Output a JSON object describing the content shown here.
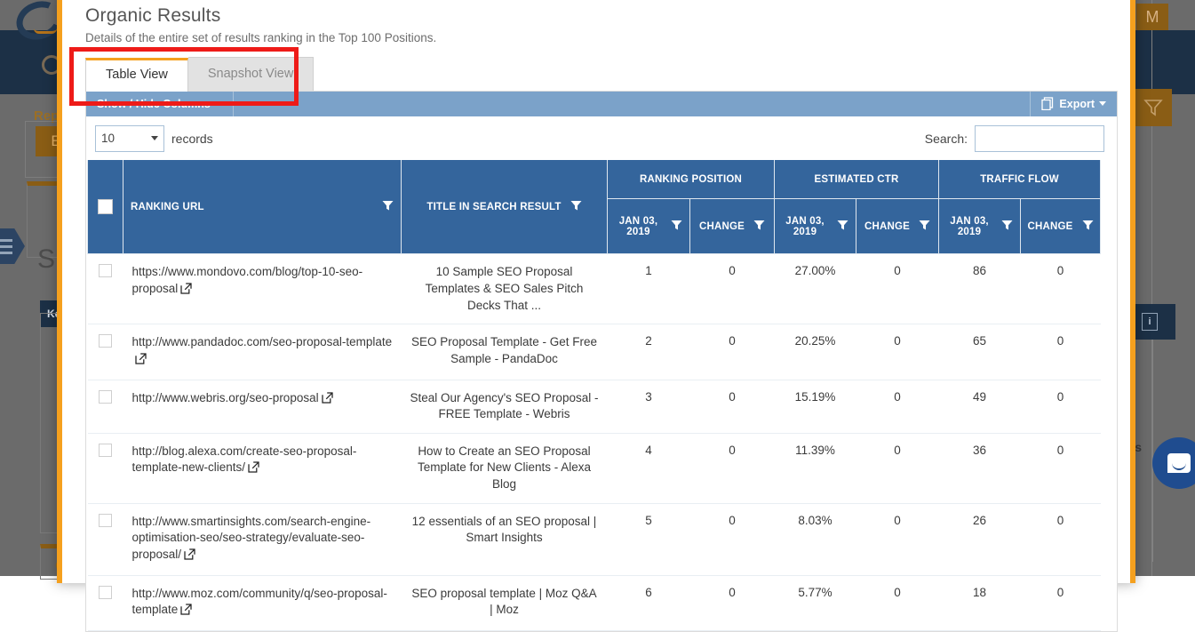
{
  "background": {
    "sidebar_letters": {
      "report": "Rep",
      "e_button": "E",
      "su": "SU",
      "key": "Ke",
      "c": "C"
    },
    "avatar_initial": "M",
    "info_glyph": "i",
    "s_letter": "s"
  },
  "modal": {
    "title": "Organic Results",
    "subtitle": "Details of the entire set of results ranking in the Top 100 Positions.",
    "tabs": [
      {
        "label": "Table View",
        "active": true
      },
      {
        "label": "Snapshot View",
        "active": false
      }
    ]
  },
  "toolbar": {
    "show_hide_columns": "Show / Hide Columns",
    "export": "Export"
  },
  "controls": {
    "length_value": "10",
    "length_label": "records",
    "search_label": "Search:",
    "search_value": "",
    "search_placeholder": ""
  },
  "table": {
    "group_headers": [
      {
        "label": "RANKING POSITION"
      },
      {
        "label": "ESTIMATED CTR"
      },
      {
        "label": "TRAFFIC FLOW"
      }
    ],
    "columns": {
      "ranking_url": "RANKING URL",
      "title_in_search_result": "TITLE IN SEARCH RESULT",
      "rank_date": "JAN 03, 2019",
      "rank_change": "CHANGE",
      "ctr_date": "JAN 03, 2019",
      "ctr_change": "CHANGE",
      "traffic_date": "JAN 03, 2019",
      "traffic_change": "CHANGE"
    },
    "rows": [
      {
        "url": "https://www.mondovo.com/blog/top-10-seo-proposal",
        "title": "10 Sample SEO Proposal Templates & SEO Sales Pitch Decks That ...",
        "rank": "1",
        "rank_change": "0",
        "ctr": "27.00%",
        "ctr_change": "0",
        "traffic": "86",
        "traffic_change": "0"
      },
      {
        "url": "http://www.pandadoc.com/seo-proposal-template",
        "title": "SEO Proposal Template - Get Free Sample - PandaDoc",
        "rank": "2",
        "rank_change": "0",
        "ctr": "20.25%",
        "ctr_change": "0",
        "traffic": "65",
        "traffic_change": "0"
      },
      {
        "url": "http://www.webris.org/seo-proposal",
        "title": "Steal Our Agency's SEO Proposal - FREE Template - Webris",
        "rank": "3",
        "rank_change": "0",
        "ctr": "15.19%",
        "ctr_change": "0",
        "traffic": "49",
        "traffic_change": "0"
      },
      {
        "url": "http://blog.alexa.com/create-seo-proposal-template-new-clients/",
        "title": "How to Create an SEO Proposal Template for New Clients - Alexa Blog",
        "rank": "4",
        "rank_change": "0",
        "ctr": "11.39%",
        "ctr_change": "0",
        "traffic": "36",
        "traffic_change": "0"
      },
      {
        "url": "http://www.smartinsights.com/search-engine-optimisation-seo/seo-strategy/evaluate-seo-proposal/",
        "title": "12 essentials of an SEO proposal | Smart Insights",
        "rank": "5",
        "rank_change": "0",
        "ctr": "8.03%",
        "ctr_change": "0",
        "traffic": "26",
        "traffic_change": "0"
      },
      {
        "url": "http://www.moz.com/community/q/seo-proposal-template",
        "title": "SEO proposal template | Moz Q&A | Moz",
        "rank": "6",
        "rank_change": "0",
        "ctr": "5.77%",
        "ctr_change": "0",
        "traffic": "18",
        "traffic_change": "0"
      }
    ]
  },
  "colors": {
    "accent_orange": "#f5a01e",
    "header_blue": "#34659c",
    "toolbar_blue": "#7ba2c9",
    "annotation_red": "#ee1b18",
    "position_cell": "#dbe5ef",
    "navy": "#1c3046"
  }
}
